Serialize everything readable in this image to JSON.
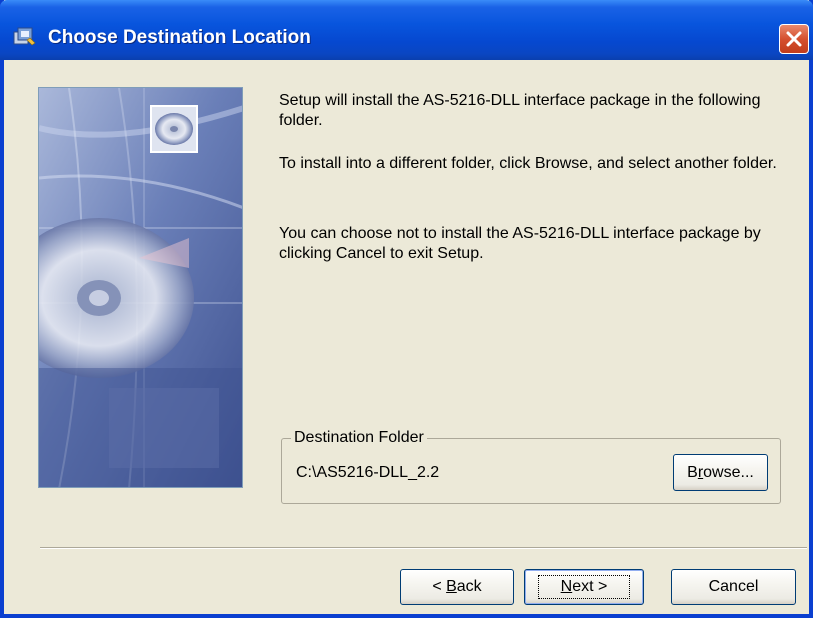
{
  "window": {
    "title": "Choose Destination Location",
    "icon": "setup-icon",
    "close": "close-icon"
  },
  "content": {
    "paragraph1": "Setup will install the AS-5216-DLL interface package in the following folder.",
    "paragraph2": "To install into a different folder, click Browse, and select another folder.",
    "paragraph3": "You can choose not to install the AS-5216-DLL interface package by clicking Cancel to exit Setup."
  },
  "destination": {
    "legend": "Destination Folder",
    "path": "C:\\AS5216-DLL_2.2",
    "browse_pre": "B",
    "browse_mnemonic": "r",
    "browse_post": "owse..."
  },
  "buttons": {
    "back_pre": "< ",
    "back_mnemonic": "B",
    "back_post": "ack",
    "next_mnemonic": "N",
    "next_post": "ext >",
    "cancel": "Cancel"
  },
  "colors": {
    "titlebar": "#0855dd",
    "dialog_bg": "#ece9d8",
    "close_button": "#d5502f"
  }
}
